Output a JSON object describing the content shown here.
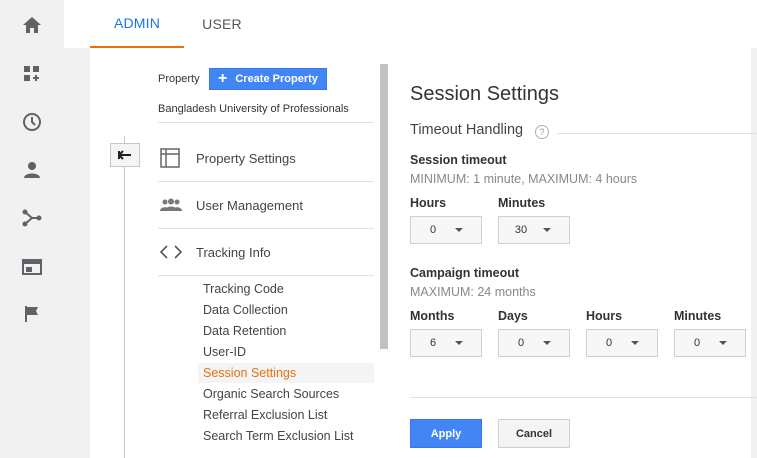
{
  "tabs": {
    "admin": "ADMIN",
    "user": "USER"
  },
  "rail_icons": [
    "home-icon",
    "dashboard-icon",
    "clock-icon",
    "person-icon",
    "share-icon",
    "display-icon",
    "flag-icon"
  ],
  "property": {
    "label": "Property",
    "create_button": "Create Property",
    "name": "Bangladesh University of Professionals"
  },
  "nav": {
    "property_settings": "Property Settings",
    "user_management": "User Management",
    "tracking_info": "Tracking Info",
    "sub_items": [
      "Tracking Code",
      "Data Collection",
      "Data Retention",
      "User-ID",
      "Session Settings",
      "Organic Search Sources",
      "Referral Exclusion List",
      "Search Term Exclusion List"
    ],
    "active_sub": "Session Settings"
  },
  "main": {
    "title": "Session Settings",
    "section_title": "Timeout Handling",
    "help_icon": "?",
    "session_timeout": {
      "label": "Session timeout",
      "hint": "MINIMUM: 1 minute, MAXIMUM: 4 hours",
      "hours_label": "Hours",
      "hours_value": "0",
      "minutes_label": "Minutes",
      "minutes_value": "30"
    },
    "campaign_timeout": {
      "label": "Campaign timeout",
      "hint": "MAXIMUM: 24 months",
      "months_label": "Months",
      "months_value": "6",
      "days_label": "Days",
      "days_value": "0",
      "hours_label": "Hours",
      "hours_value": "0",
      "minutes_label": "Minutes",
      "minutes_value": "0"
    },
    "apply_button": "Apply",
    "cancel_button": "Cancel"
  },
  "colors": {
    "accent_blue": "#4285f4",
    "tab_blue": "#1a73e8",
    "active_orange": "#e8710a",
    "rail_gray": "#f1f1f1"
  }
}
